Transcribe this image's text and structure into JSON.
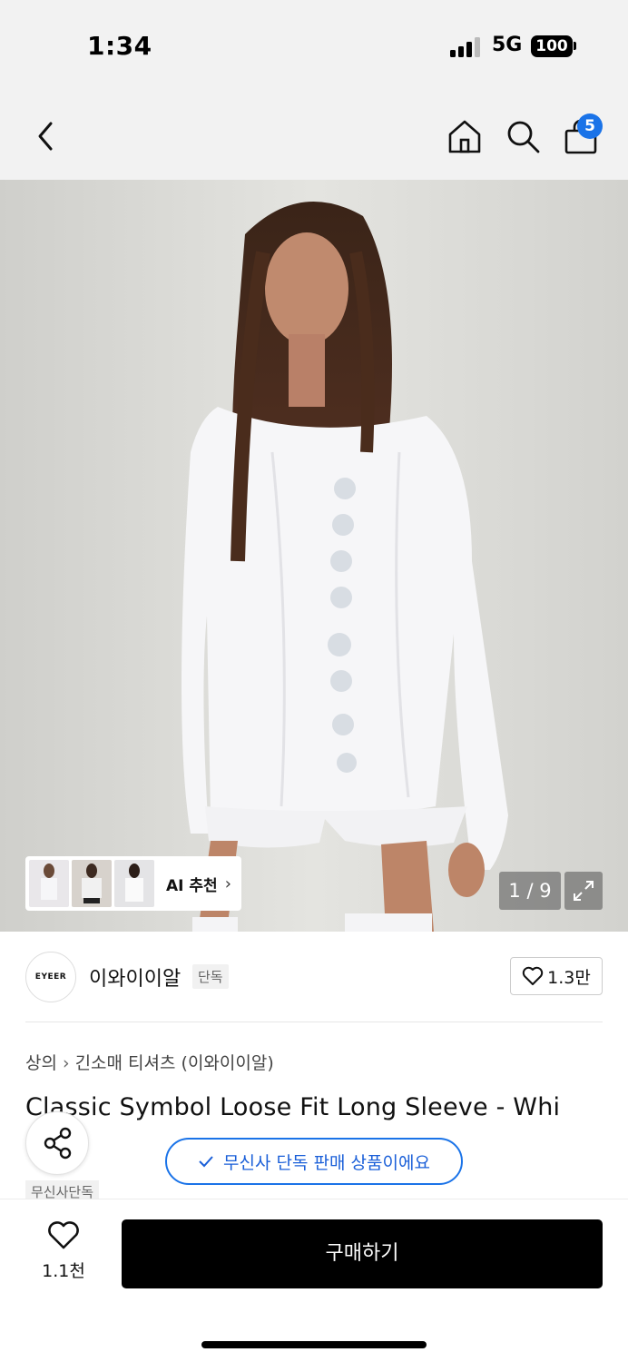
{
  "status_bar": {
    "time": "1:34",
    "network": "5G",
    "battery": "100"
  },
  "header": {
    "icons": [
      "back-icon",
      "home-icon",
      "search-icon",
      "cart-icon"
    ],
    "cart_count": "5"
  },
  "gallery": {
    "ai_recommend_label": "AI 추천",
    "counter": "1 / 9"
  },
  "brand": {
    "logo_text": "EYEER",
    "name": "이와이이알",
    "tag": "단독",
    "likes": "1.3만"
  },
  "product": {
    "breadcrumb_category": "상의",
    "breadcrumb_sub": "긴소매 티셔츠 (이와이이알)",
    "title": "Classic Symbol Loose Fit Long Sleeve - Whi",
    "exclusive_notice": "무신사 단독 판매 상품이에요",
    "exclusive_tag": "무신사단독"
  },
  "bottom_bar": {
    "wish_count": "1.1천",
    "buy_label": "구매하기"
  },
  "colors": {
    "accent_blue": "#1a73e8",
    "buy_button": "#000000",
    "header_bg": "#f2f2f2"
  }
}
